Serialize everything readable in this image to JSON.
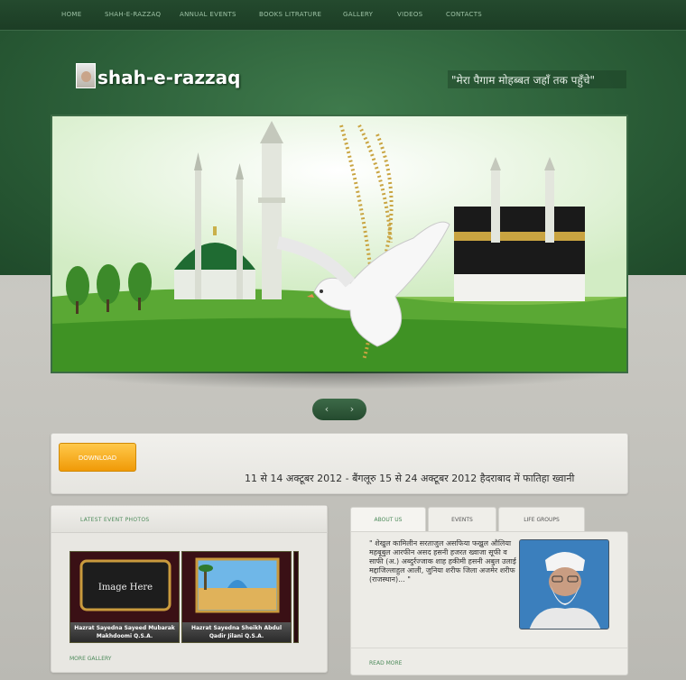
{
  "nav": {
    "items": [
      "HOME",
      "SHAH-E-RAZZAQ",
      "ANNUAL EVENTS",
      "BOOKS LITRATURE",
      "GALLERY",
      "VIDEOS",
      "CONTACTS"
    ]
  },
  "header": {
    "logo_text": "shah-e-razzaq",
    "tagline": "\"मेरा पैगाम मोहब्बत जहाँ तक पहुँचे\""
  },
  "slider": {
    "prev_label": "‹",
    "next_label": "›"
  },
  "download": {
    "button_label": "DOWNLOAD",
    "marquee": "11 से 14 अक्टूबर 2012 - बैंगलूरु 15 से 24 अक्टूबर 2012 हैदराबाद में फातिहा ख्वानी"
  },
  "photos_panel": {
    "title": "LATEST EVENT PHOTOS",
    "thumbs": [
      {
        "image_text": "Image Here",
        "caption": "Hazrat Sayedna Sayeed Mubarak Makhdoomi Q.S.A."
      },
      {
        "caption": "Hazrat Sayedna Sheikh Abdul Qadir Jilani Q.S.A."
      }
    ],
    "more_label": "MORE GALLERY"
  },
  "tabs": {
    "items": [
      "ABOUT US",
      "EVENTS",
      "LIFE GROUPS"
    ],
    "active": "ABOUT US"
  },
  "about": {
    "text": "\" शेखुल कामिलीन सरताजुल असफिया फख्रुल औलिया महबूबुल आरफीन असद हसनी हजरत ख्वाजा सूफी व साफी (अ.) अब्दुर्रज्जाक शाह हकीमी हसनी अबुल उलाई मद्दाजिल्लाहुल आली, जुनिया शरीफ जिला अजमेर शरीफ (राजस्थान)... \"",
    "read_more": "READ MORE"
  },
  "colors": {
    "accent_green": "#4c8a5a",
    "header_green": "#2b5e38",
    "download_orange": "#f09a07"
  }
}
